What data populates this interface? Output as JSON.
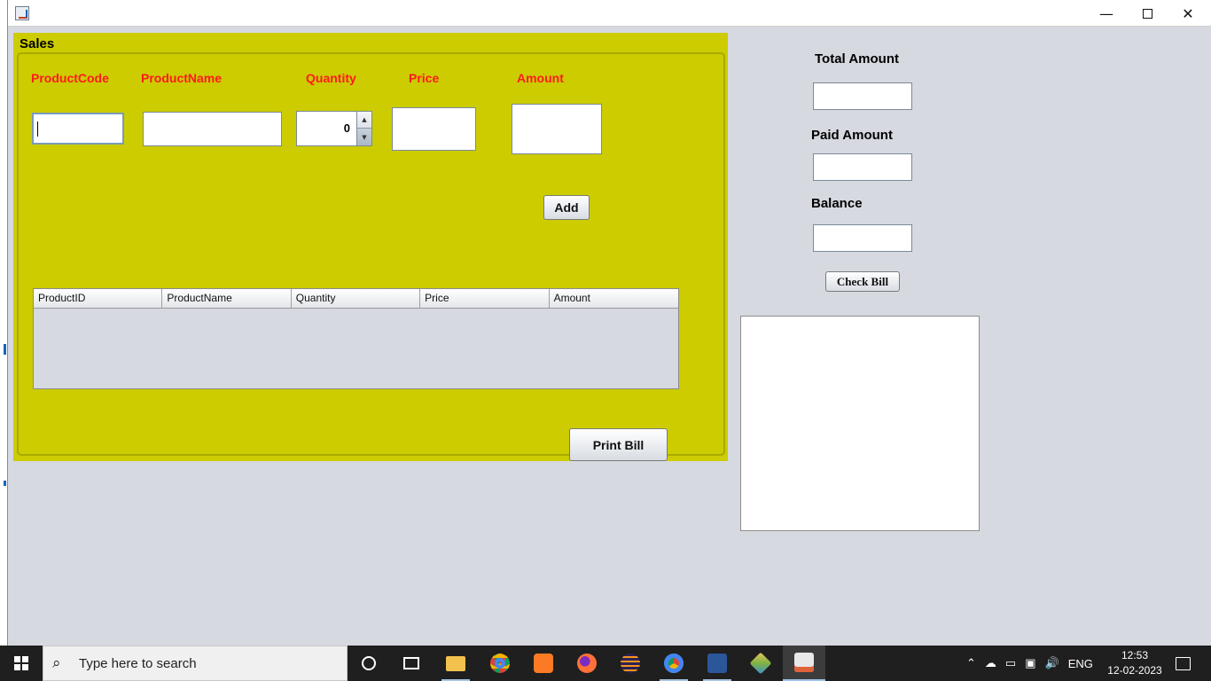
{
  "window": {
    "title": ""
  },
  "sales": {
    "title": "Sales",
    "columns": [
      "ProductCode",
      "ProductName",
      "Quantity",
      "Price",
      "Amount"
    ],
    "product_code_value": "",
    "product_name_value": "",
    "quantity_value": "0",
    "price_value": "",
    "amount_value": "",
    "add_label": "Add",
    "print_label": "Print Bill",
    "table_headers": [
      "ProductID",
      "ProductName",
      "Quantity",
      "Price",
      "Amount"
    ]
  },
  "summary": {
    "total_label": "Total Amount",
    "paid_label": "Paid Amount",
    "balance_label": "Balance",
    "check_label": "Check Bill"
  },
  "taskbar": {
    "search_placeholder": "Type here to search",
    "lang": "ENG",
    "time": "12:53",
    "date": "12-02-2023"
  },
  "colors": {
    "panel": "#cccc00",
    "label": "#ff1a1a",
    "background": "#d6d9e0"
  }
}
